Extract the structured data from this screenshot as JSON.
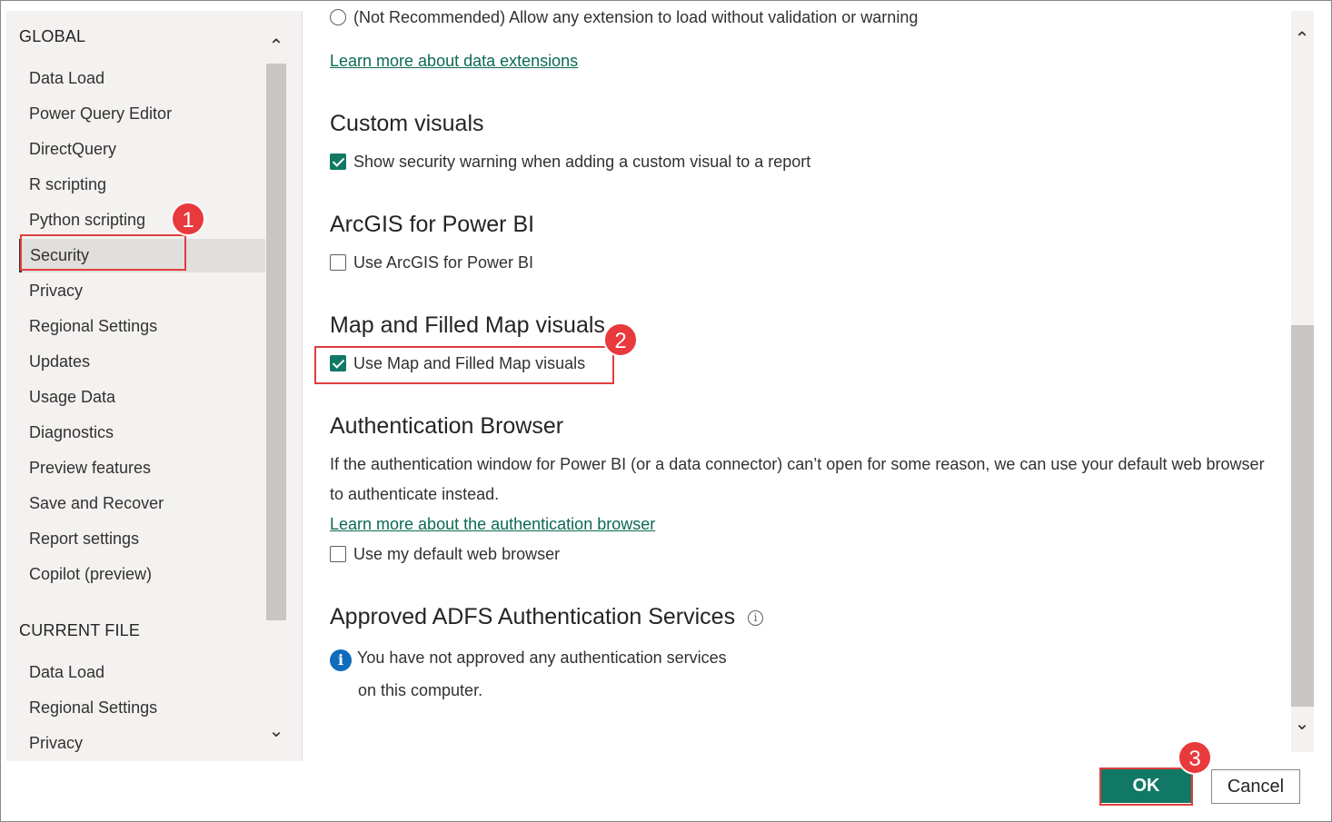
{
  "sidebar": {
    "global_title": "GLOBAL",
    "global_items": [
      {
        "label": "Data Load"
      },
      {
        "label": "Power Query Editor"
      },
      {
        "label": "DirectQuery"
      },
      {
        "label": "R scripting"
      },
      {
        "label": "Python scripting"
      },
      {
        "label": "Security"
      },
      {
        "label": "Privacy"
      },
      {
        "label": "Regional Settings"
      },
      {
        "label": "Updates"
      },
      {
        "label": "Usage Data"
      },
      {
        "label": "Diagnostics"
      },
      {
        "label": "Preview features"
      },
      {
        "label": "Save and Recover"
      },
      {
        "label": "Report settings"
      },
      {
        "label": "Copilot (preview)"
      }
    ],
    "selected": "Security",
    "current_file_title": "CURRENT FILE",
    "current_file_items": [
      {
        "label": "Data Load"
      },
      {
        "label": "Regional Settings"
      },
      {
        "label": "Privacy"
      }
    ]
  },
  "main": {
    "extension_radio_label": "(Not Recommended) Allow any extension to load without validation or warning",
    "extensions_link": "Learn more about data extensions",
    "custom_visuals": {
      "title": "Custom visuals",
      "checkbox_label": "Show security warning when adding a custom visual to a report",
      "checked": true
    },
    "arcgis": {
      "title": "ArcGIS for Power BI",
      "checkbox_label": "Use ArcGIS for Power BI",
      "checked": false
    },
    "map_visuals": {
      "title": "Map and Filled Map visuals",
      "checkbox_label": "Use Map and Filled Map visuals",
      "checked": true
    },
    "auth_browser": {
      "title": "Authentication Browser",
      "description_line1": "If the authentication window for Power BI (or a data connector) can’t open for some reason, we can use your default web browser",
      "description_line2": "to authenticate instead.",
      "link": "Learn more about the authentication browser",
      "checkbox_label": "Use my default web browser",
      "checked": false
    },
    "adfs": {
      "title": "Approved ADFS Authentication Services",
      "info_line1": "You have not approved any authentication services",
      "info_line2": "on this computer."
    }
  },
  "buttons": {
    "ok": "OK",
    "cancel": "Cancel"
  },
  "callouts": {
    "step1": "1",
    "step2": "2",
    "step3": "3",
    "color": "#e03e3e"
  },
  "colors": {
    "accent": "#117865",
    "link": "#0b6a52",
    "info_blue": "#0f6cbd"
  },
  "icons": {
    "scroll_up": "chevron-up-icon",
    "scroll_down": "chevron-down-icon",
    "info": "info-icon"
  }
}
